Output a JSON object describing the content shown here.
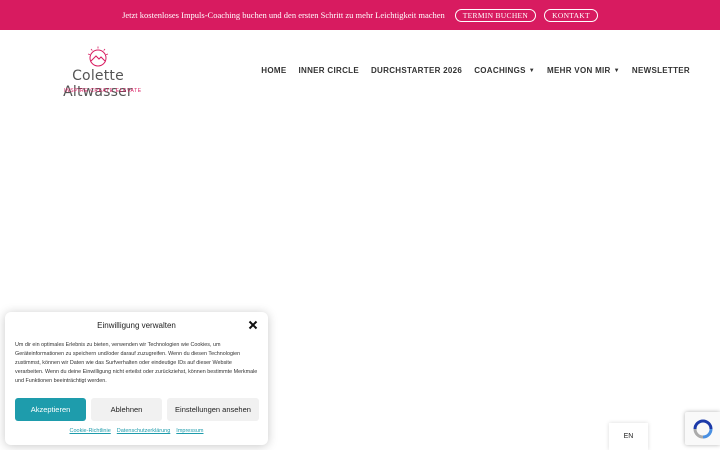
{
  "topbar": {
    "text": "Jetzt kostenloses Impuls-Coaching buchen und den ersten Schritt zu mehr Leichtigkeit machen",
    "termin_label": "TERMIN BUCHEN",
    "kontakt_label": "KONTAKT",
    "color": "#d81b60"
  },
  "logo": {
    "name": "Colette Altwasser",
    "tagline": "INSPIRE  CREATE  ELEVATE"
  },
  "nav": {
    "items": [
      {
        "label": "HOME",
        "has_dropdown": false
      },
      {
        "label": "INNER CIRCLE",
        "has_dropdown": false
      },
      {
        "label": "DURCHSTARTER 2026",
        "has_dropdown": false
      },
      {
        "label": "COACHINGS",
        "has_dropdown": true
      },
      {
        "label": "MEHR VON MIR",
        "has_dropdown": true
      },
      {
        "label": "NEWSLETTER",
        "has_dropdown": false
      }
    ]
  },
  "cookie": {
    "title": "Einwilligung verwalten",
    "text": "Um dir ein optimales Erlebnis zu bieten, verwenden wir Technologien wie Cookies, um Geräteinformationen zu speichern und/oder darauf zuzugreifen. Wenn du diesen Technologien zustimmst, können wir Daten wie das Surfverhalten oder eindeutige IDs auf dieser Website verarbeiten. Wenn du deine Einwilligung nicht erteilst oder zurückziehst, können bestimmte Merkmale und Funktionen beeinträchtigt werden.",
    "accept_label": "Akzeptieren",
    "deny_label": "Ablehnen",
    "settings_label": "Einstellungen ansehen",
    "links": [
      "Cookie-Richtlinie",
      "Datenschutzerklärung",
      "Impressum"
    ],
    "accent": "#1e9cac"
  },
  "language": {
    "label": "EN"
  }
}
